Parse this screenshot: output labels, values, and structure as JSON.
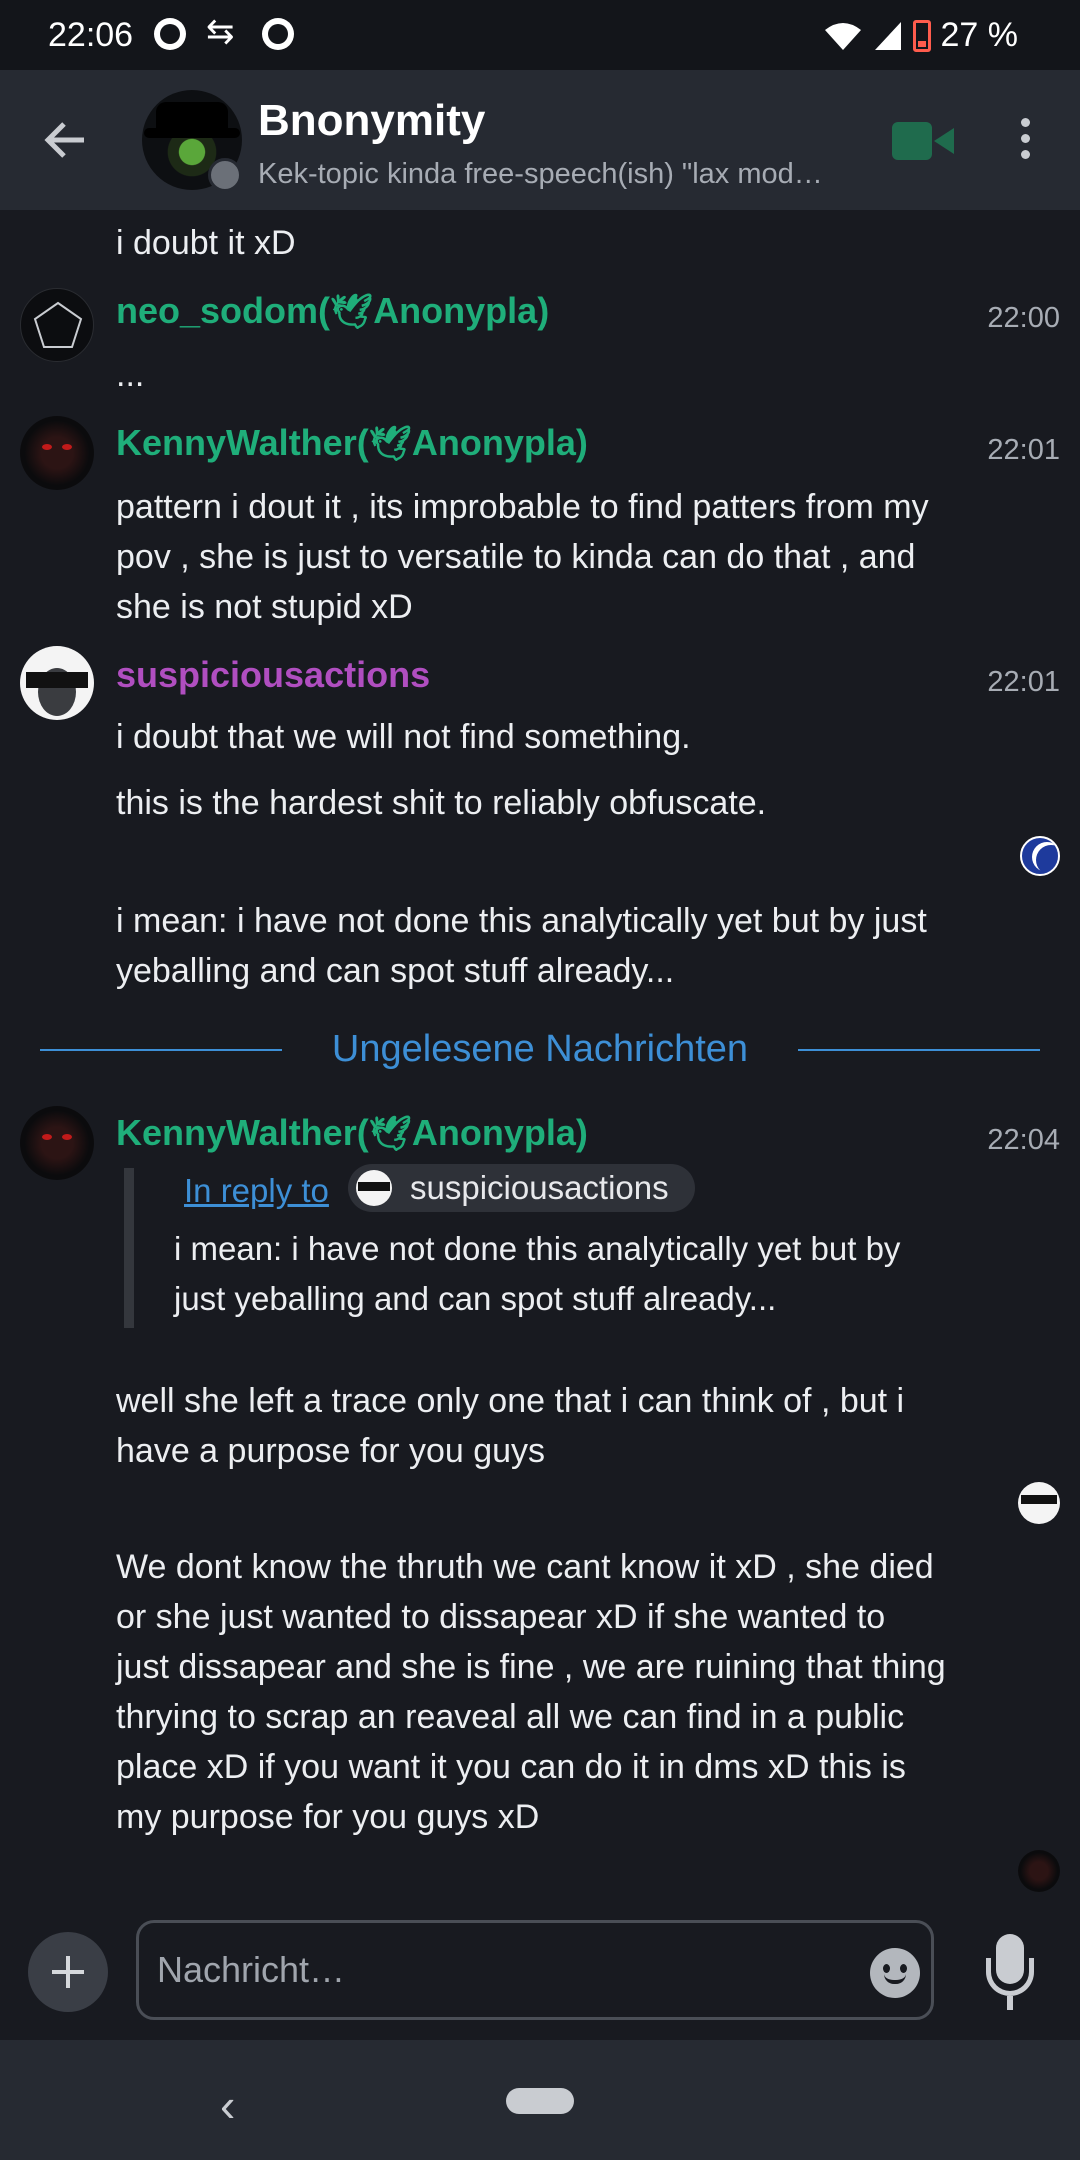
{
  "status_bar": {
    "time": "22:06",
    "battery": "27 %",
    "icons": [
      "notification-dot-icon",
      "data-transfer-icon",
      "notification-dot-icon",
      "wifi-icon",
      "signal-icon",
      "battery-icon"
    ]
  },
  "header": {
    "title": "Bnonymity",
    "subtitle": "Kek-topic kinda free-speech(ish) \"lax mod…",
    "icons": [
      "back-arrow-icon",
      "group-avatar",
      "video-call-icon",
      "more-vert-icon"
    ]
  },
  "messages": {
    "m0": {
      "text": "i doubt it xD"
    },
    "m1": {
      "sender_name": "neo_sodom(",
      "sender_tag": "Anonypla)",
      "time": "22:00",
      "text": "..."
    },
    "m2": {
      "sender_name": "KennyWalther(",
      "sender_tag": "Anonypla)",
      "time": "22:01",
      "text": "pattern i dout it , its improbable to find patters from my pov , she is just to versatile to kinda can do that , and she is not stupid xD"
    },
    "m3": {
      "sender": "suspiciousactions",
      "time": "22:01",
      "lines": [
        "i doubt that we will not find something.",
        "this is the hardest shit to reliably obfuscate.",
        "i mean: i have not done this analytically yet but by just yeballing and can spot stuff already..."
      ]
    },
    "divider": "Ungelesene Nachrichten",
    "m4": {
      "sender_name": "KennyWalther(",
      "sender_tag": "Anonypla)",
      "time": "22:04",
      "reply_link": "In reply to",
      "reply_sender": "suspiciousactions",
      "reply_text": "i mean: i have not done this analytically yet but by just yeballing and can spot stuff already...",
      "text1": "well she left a trace only one that i can think of , but i have a purpose for you guys",
      "text2": "We dont know the thruth we cant know it xD , she died or she just wanted to dissapear xD if she wanted to just dissapear and she is fine , we are ruining that thing thrying to scrap an reaveal all we can find in a public place xD if you want it you can do it in dms xD this is my purpose for you guys xD"
    }
  },
  "composer": {
    "placeholder": "Nachricht…"
  },
  "colors": {
    "accent_green": "#1fae7a",
    "accent_purple": "#b04ec0",
    "link_blue": "#3d8fd6",
    "background": "#181a20",
    "appbar": "#262a32"
  }
}
